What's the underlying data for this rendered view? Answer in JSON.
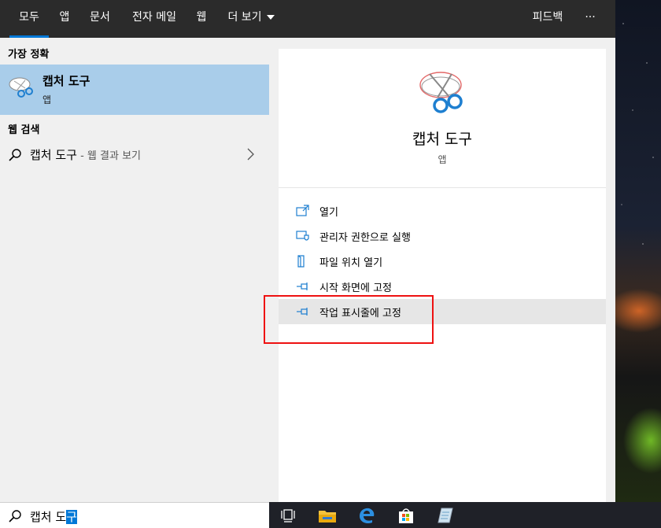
{
  "nav": {
    "tabs": [
      "모두",
      "앱",
      "문서",
      "전자 메일",
      "웹"
    ],
    "more_label": "더 보기",
    "feedback_label": "피드백",
    "ellipsis_label": "···"
  },
  "left": {
    "best_match_header": "가장 정확",
    "best_match": {
      "title": "캡처 도구",
      "subtitle": "앱",
      "icon": "snipping-tool-icon"
    },
    "web_search_header": "웹 검색",
    "web_result": {
      "query": "캡처 도구",
      "suffix": " - 웹 결과 보기",
      "icon": "search-icon"
    }
  },
  "right": {
    "app_title": "캡처 도구",
    "app_subtitle": "앱",
    "actions": [
      {
        "label": "열기",
        "icon": "open-icon"
      },
      {
        "label": "관리자 권한으로 실행",
        "icon": "admin-shield-icon"
      },
      {
        "label": "파일 위치 열기",
        "icon": "file-location-icon"
      },
      {
        "label": "시작 화면에 고정",
        "icon": "pin-icon"
      },
      {
        "label": "작업 표시줄에 고정",
        "icon": "pin-icon"
      }
    ]
  },
  "search": {
    "value_plain": "캡처 도",
    "value_selected": "구",
    "icon": "search-icon"
  },
  "taskbar": {
    "items": [
      "task-view-icon",
      "file-explorer-icon",
      "edge-icon",
      "store-icon",
      "notepad-icon"
    ]
  },
  "colors": {
    "accent": "#0078d7",
    "selection": "#a9cdea",
    "highlight_box": "#e11111"
  }
}
